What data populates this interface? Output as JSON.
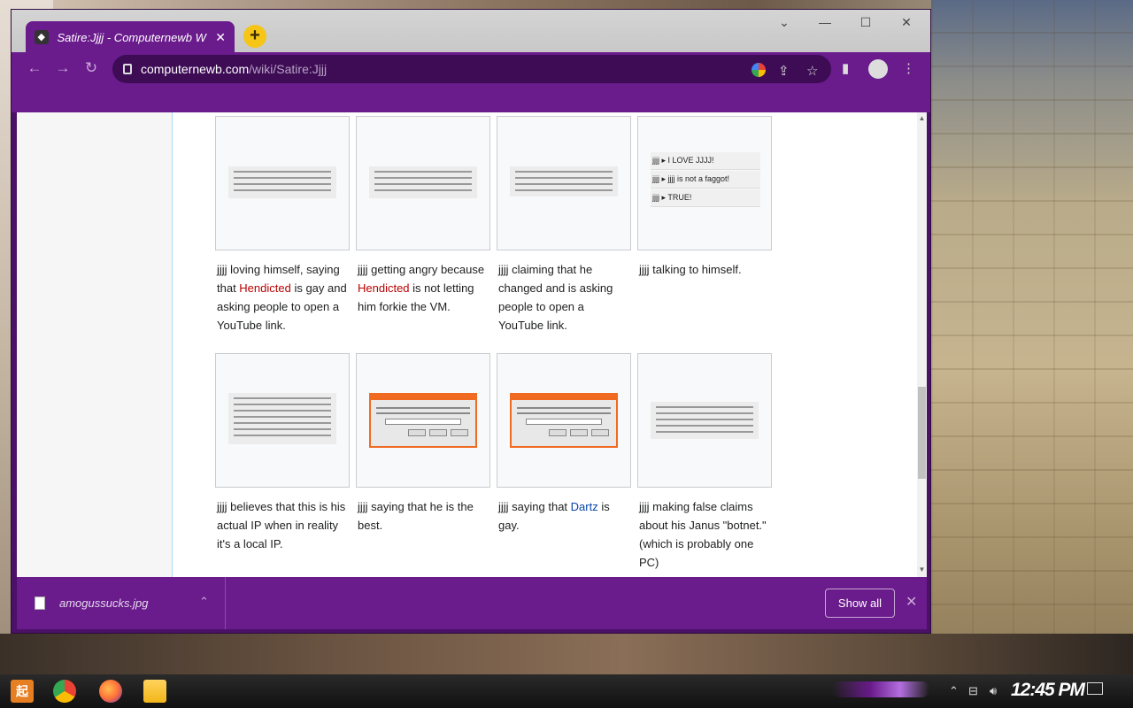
{
  "browser": {
    "tab_title": "Satire:Jjjj - Computernewb W",
    "url_domain": "computernewb.com",
    "url_path": "/wiki/Satire:Jjjj"
  },
  "gallery": [
    [
      {
        "caption_pre": "jjjj loving himself, saying that ",
        "link": "Hendicted",
        "link_style": "red",
        "caption_post": " is gay and asking people to open a YouTube link.",
        "thumb": "chat"
      },
      {
        "caption_pre": "jjjj getting angry because ",
        "link": "Hendicted",
        "link_style": "red",
        "caption_post": " is not letting him forkie the VM.",
        "thumb": "chat"
      },
      {
        "caption_pre": "jjjj claiming that he changed and is asking people to open a YouTube link.",
        "link": "",
        "link_style": "",
        "caption_post": "",
        "thumb": "chat"
      },
      {
        "caption_pre": "jjjj talking to himself.",
        "link": "",
        "link_style": "",
        "caption_post": "",
        "thumb": "love"
      }
    ],
    [
      {
        "caption_pre": "jjjj believes that this is his actual IP when in reality it's a local IP.",
        "link": "",
        "link_style": "",
        "caption_post": "",
        "thumb": "chat"
      },
      {
        "caption_pre": "jjjj saying that he is the best.",
        "link": "",
        "link_style": "",
        "caption_post": "",
        "thumb": "run"
      },
      {
        "caption_pre": "jjjj saying that ",
        "link": "Dartz",
        "link_style": "blue",
        "caption_post": " is gay.",
        "thumb": "run"
      },
      {
        "caption_pre": "jjjj making false claims about his Janus \"botnet.\" (which is probably one PC)",
        "link": "",
        "link_style": "",
        "caption_post": "",
        "thumb": "chat"
      }
    ]
  ],
  "thumb_love_lines": [
    "jjjj ▸  I LOVE JJJJ!",
    "jjjj ▸ jjjj is not a faggot!",
    "jjjj ▸  TRUE!"
  ],
  "download": {
    "filename": "amogussucks.jpg",
    "show_all_label": "Show all"
  },
  "taskbar": {
    "clock": "12:45 PM"
  },
  "colors": {
    "browser_purple": "#6a1b8c",
    "red_link": "#ba0000",
    "blue_link": "#0645ad",
    "accent_yellow": "#f5c518"
  }
}
